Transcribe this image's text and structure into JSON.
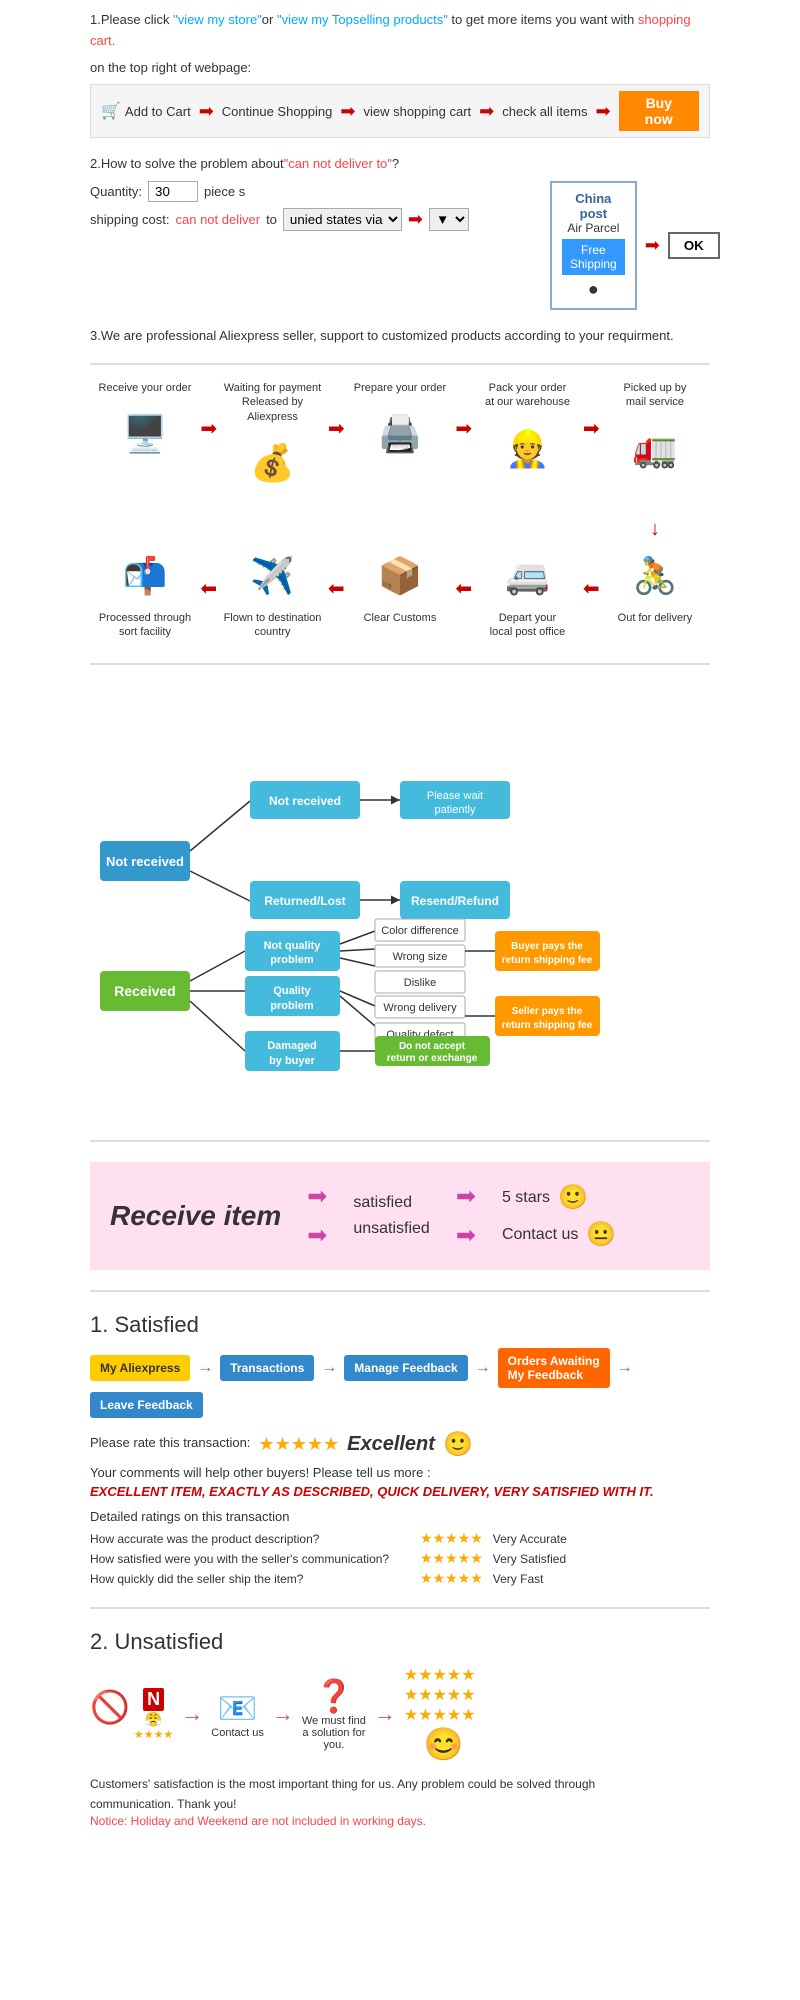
{
  "step1": {
    "text1": "1.Please click ",
    "link1": "\"view my store\"",
    "text2": "or ",
    "link2": "\"view my Topselling products\"",
    "text3": " to get more items you want with",
    "link3": "shopping cart.",
    "text4": "on the top right of webpage:",
    "bar": {
      "add_to_cart": "Add to Cart",
      "continue": "Continue Shopping",
      "view_cart": "view shopping cart",
      "check_all": "check all items",
      "buy_now": "Buy now"
    }
  },
  "step2": {
    "title": "2.How to solve the problem about",
    "cant_deliver": "\"can not deliver to\"",
    "text2": "?",
    "qty_label": "Quantity:",
    "qty_value": "30",
    "pieces": "piece s",
    "shipping_label": "shipping cost:",
    "cant_deliver2": "can not deliver",
    "to": " to ",
    "via": "unied states via",
    "china_post_title": "China post",
    "air_parcel": "Air Parcel",
    "free_shipping": "Free\nShipping",
    "ok": "OK"
  },
  "step3": {
    "text": "3.We are professional Aliexpress seller, support to customized products according to your requirment."
  },
  "process": {
    "row1": [
      {
        "label": "Receive your order",
        "icon": "🖥️"
      },
      {
        "label": "Waiting for payment\nReleased by Aliexpress",
        "icon": "💰"
      },
      {
        "label": "Prepare your order",
        "icon": "🖨️"
      },
      {
        "label": "Pack your order\nat our warehouse",
        "icon": "👷"
      },
      {
        "label": "Picked up by\nmail service",
        "icon": "🚛"
      }
    ],
    "row2": [
      {
        "label": "Out for delivery",
        "icon": "🚴"
      },
      {
        "label": "Depart your\nlocal post office",
        "icon": "🚐"
      },
      {
        "label": "Clear Customs",
        "icon": "📦"
      },
      {
        "label": "Flown to destination\ncountry",
        "icon": "✈️"
      },
      {
        "label": "Processed through\nsort facility",
        "icon": "📬"
      }
    ]
  },
  "receive": {
    "title": "Receive item",
    "satisfied": "satisfied",
    "unsatisfied": "unsatisfied",
    "five_stars": "5 stars",
    "contact_us": "Contact us"
  },
  "satisfied": {
    "title": "1. Satisfied",
    "flow": [
      {
        "label": "My Aliexpress",
        "style": "yellow"
      },
      {
        "label": "Transactions",
        "style": "blue"
      },
      {
        "label": "Manage Feedback",
        "style": "blue"
      },
      {
        "label": "Orders Awaiting\nMy Feedback",
        "style": "orange"
      },
      {
        "label": "Leave Feedback",
        "style": "blue"
      }
    ],
    "rate_text": "Please rate this transaction:",
    "excellent": "Excellent",
    "comments": "Your comments will help other buyers! Please tell us more :",
    "review": "EXCELLENT ITEM, EXACTLY AS DESCRIBED, QUICK DELIVERY, VERY SATISFIED WITH IT.",
    "detailed": "Detailed ratings on this transaction",
    "ratings": [
      {
        "label": "How accurate was the product description?",
        "quality": "Very Accurate"
      },
      {
        "label": "How satisfied were you with the seller's communication?",
        "quality": "Very Satisfied"
      },
      {
        "label": "How quickly did the seller ship the item?",
        "quality": "Very Fast"
      }
    ]
  },
  "unsatisfied": {
    "title": "2. Unsatisfied",
    "flow_items": [
      {
        "icon": "🚫",
        "sub": "⭐⭐⭐⭐",
        "label": ""
      },
      {
        "icon": "😤",
        "label": ""
      },
      {
        "icon": "📧",
        "label": "Contact us"
      },
      {
        "icon": "❓",
        "label": "We must find\na solution for\nyou."
      },
      {
        "icon": "⭐⭐⭐⭐⭐",
        "sub": "⭐⭐⭐⭐⭐",
        "label": ""
      },
      {
        "icon": "😊",
        "label": ""
      }
    ],
    "notice": "Customers' satisfaction is the most important thing for us. Any problem could be solved through\ncommunication. Thank you!",
    "holiday": "Notice: Holiday and Weekend are not included in working days."
  }
}
